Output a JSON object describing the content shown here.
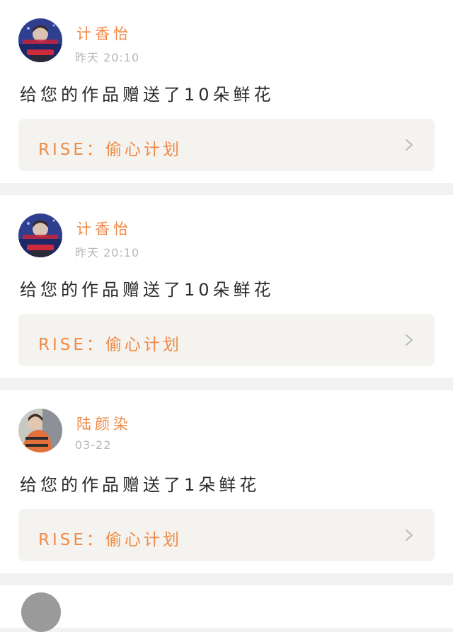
{
  "feed": [
    {
      "user": "计香怡",
      "time": "昨天 20:10",
      "avatar_kind": "idol-portrait-blue",
      "message": "给您的作品赠送了10朵鲜花",
      "work_title": "RISE：偷心计划",
      "chevron_icon": "chevron-right-icon"
    },
    {
      "user": "计香怡",
      "time": "昨天 20:10",
      "avatar_kind": "idol-portrait-blue",
      "message": "给您的作品赠送了10朵鲜花",
      "work_title": "RISE：偷心计划",
      "chevron_icon": "chevron-right-icon"
    },
    {
      "user": "陆颜染",
      "time": "03-22",
      "avatar_kind": "orange-jacket-photo",
      "message": "给您的作品赠送了1朵鲜花",
      "work_title": "RISE：偷心计划",
      "chevron_icon": "chevron-right-icon"
    }
  ],
  "colors": {
    "accent": "#f08a47",
    "timestamp": "#b7b7b7",
    "text": "#2a2a2a",
    "link_background": "#f4f3ef",
    "page_background": "#f2f2f2"
  }
}
